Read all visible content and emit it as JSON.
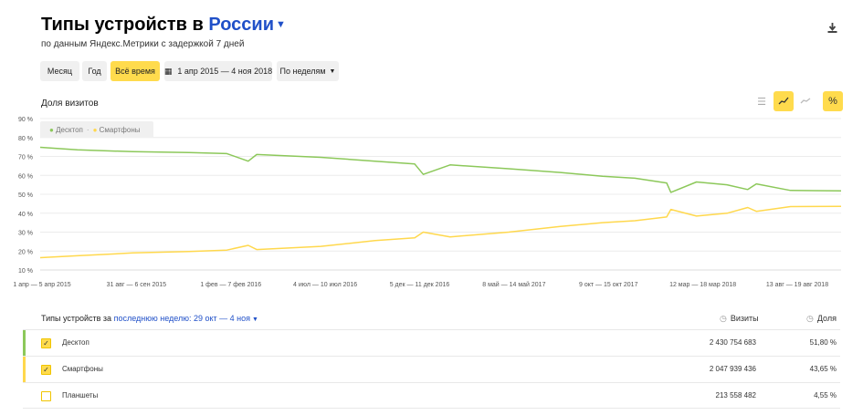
{
  "header": {
    "title_prefix": "Типы устройств в",
    "region": "России",
    "subtitle": "по данным Яндекс.Метрики с задержкой 7 дней"
  },
  "period_buttons": [
    "Месяц",
    "Год",
    "Всё время"
  ],
  "active_period": "Всё время",
  "date_range": "1 апр 2015 — 4 ноя 2018",
  "grouping": "По неделям",
  "chart_section_label": "Доля визитов",
  "chart_modes": [
    "stacked",
    "line",
    "area",
    "percent"
  ],
  "colors": {
    "accent": "#ffdb4d",
    "link": "#2050c8",
    "desktop": "#8cc85a",
    "smartphones": "#ffd84d",
    "tablets": "#ffe88a"
  },
  "chart_data": {
    "type": "line",
    "title": "Доля визитов",
    "ylim": [
      10,
      90
    ],
    "y_ticks": [
      "10 %",
      "20 %",
      "30 %",
      "40 %",
      "50 %",
      "60 %",
      "70 %",
      "80 %",
      "90 %"
    ],
    "x_tick_labels": [
      "1 апр — 5 апр 2015",
      "31 авг — 6 сен 2015",
      "1 фев — 7 фев 2016",
      "4 июл — 10 июл 2016",
      "5 дек — 11 дек 2016",
      "8 май — 14 май 2017",
      "9 окт — 15 окт 2017",
      "12 мар — 18 мар 2018",
      "13 авг — 19 авг 2018"
    ],
    "x": [
      "2015-04-01",
      "2015-06-01",
      "2015-08-31",
      "2015-12-01",
      "2016-02-01",
      "2016-03-07",
      "2016-03-21",
      "2016-07-04",
      "2016-10-01",
      "2016-12-05",
      "2016-12-19",
      "2017-02-01",
      "2017-05-08",
      "2017-08-01",
      "2017-10-09",
      "2017-12-01",
      "2018-01-22",
      "2018-01-29",
      "2018-03-12",
      "2018-05-01",
      "2018-06-04",
      "2018-06-18",
      "2018-08-13",
      "2018-11-04"
    ],
    "series": [
      {
        "name": "Десктоп",
        "values": [
          74.8,
          73.5,
          72.5,
          72,
          71.5,
          67.5,
          71,
          69.5,
          67.5,
          66,
          60.5,
          65.5,
          63.5,
          61.5,
          59.5,
          58.5,
          56,
          51,
          56.5,
          55,
          52.5,
          55.5,
          52,
          51.8
        ]
      },
      {
        "name": "Смартфоны",
        "values": [
          16.5,
          17.5,
          19,
          19.8,
          20.5,
          23,
          20.8,
          22.5,
          25.5,
          27,
          30,
          27.5,
          30,
          33,
          35,
          36,
          38,
          42,
          38.5,
          40,
          43,
          41,
          43.5,
          43.65
        ]
      }
    ]
  },
  "legend": [
    "Десктоп",
    "Смартфоны"
  ],
  "table": {
    "title_prefix": "Типы устройств за",
    "period_label": "последнюю неделю: 29 окт — 4 ноя",
    "col_visits": "Визиты",
    "col_share": "Доля",
    "rows": [
      {
        "name": "Десктоп",
        "visits": "2 430 754 683",
        "share": "51,80 %",
        "checked": true
      },
      {
        "name": "Смартфоны",
        "visits": "2 047 939 436",
        "share": "43,65 %",
        "checked": true
      },
      {
        "name": "Планшеты",
        "visits": "213 558 482",
        "share": "4,55 %",
        "checked": false
      }
    ]
  }
}
